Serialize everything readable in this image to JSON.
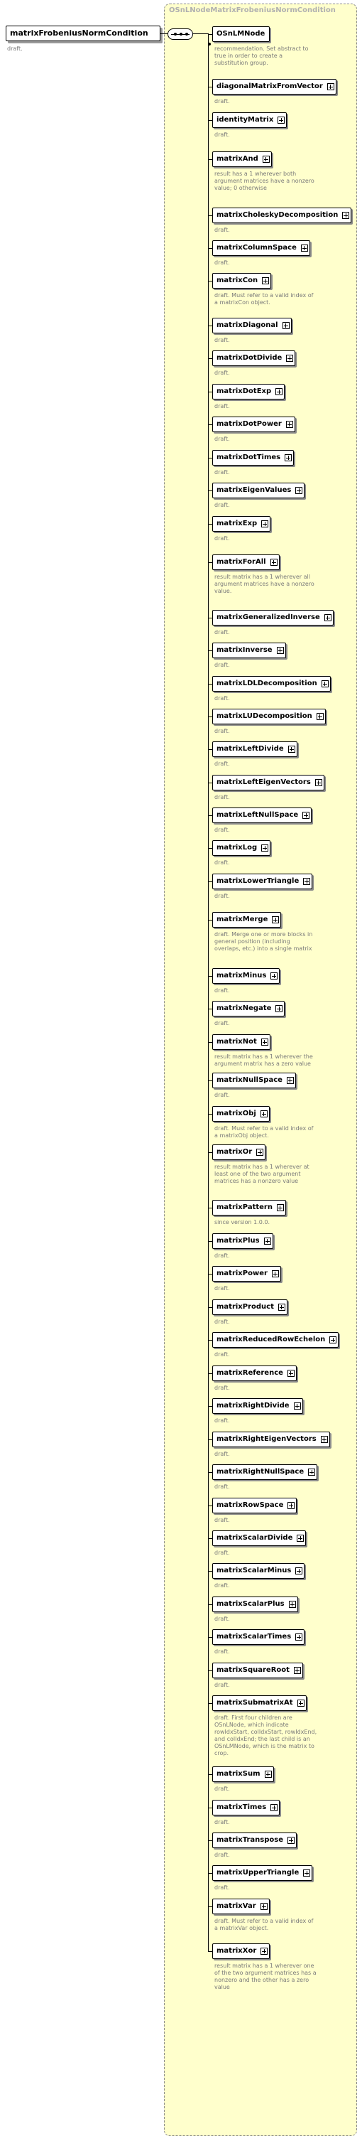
{
  "root": {
    "name": "matrixFrobeniusNormCondition",
    "description": "draft."
  },
  "group": {
    "title": "OSnLNodeMatrixFrobeniusNormCondition"
  },
  "children": [
    {
      "name": "OSnLMNode",
      "expandable": false,
      "description": "recommendation. Set abstract to true in order to create a substitution group."
    },
    {
      "name": "diagonalMatrixFromVector",
      "expandable": true,
      "description": "draft."
    },
    {
      "name": "identityMatrix",
      "expandable": true,
      "description": "draft."
    },
    {
      "name": "matrixAnd",
      "expandable": true,
      "description": "result has a 1 wherever both argument matrices have a nonzero value; 0 otherwise"
    },
    {
      "name": "matrixCholeskyDecomposition",
      "expandable": true,
      "description": "draft."
    },
    {
      "name": "matrixColumnSpace",
      "expandable": true,
      "description": "draft."
    },
    {
      "name": "matrixCon",
      "expandable": true,
      "description": "draft. Must refer to a valid index of a matrixCon object."
    },
    {
      "name": "matrixDiagonal",
      "expandable": true,
      "description": "draft."
    },
    {
      "name": "matrixDotDivide",
      "expandable": true,
      "description": "draft."
    },
    {
      "name": "matrixDotExp",
      "expandable": true,
      "description": "draft."
    },
    {
      "name": "matrixDotPower",
      "expandable": true,
      "description": "draft."
    },
    {
      "name": "matrixDotTimes",
      "expandable": true,
      "description": "draft."
    },
    {
      "name": "matrixEigenValues",
      "expandable": true,
      "description": "draft."
    },
    {
      "name": "matrixExp",
      "expandable": true,
      "description": "draft."
    },
    {
      "name": "matrixForAll",
      "expandable": true,
      "description": "result matrix has a 1 wherever all argument matrices have a nonzero value."
    },
    {
      "name": "matrixGeneralizedInverse",
      "expandable": true,
      "description": "draft."
    },
    {
      "name": "matrixInverse",
      "expandable": true,
      "description": "draft."
    },
    {
      "name": "matrixLDLDecomposition",
      "expandable": true,
      "description": "draft."
    },
    {
      "name": "matrixLUDecomposition",
      "expandable": true,
      "description": "draft."
    },
    {
      "name": "matrixLeftDivide",
      "expandable": true,
      "description": "draft."
    },
    {
      "name": "matrixLeftEigenVectors",
      "expandable": true,
      "description": "draft."
    },
    {
      "name": "matrixLeftNullSpace",
      "expandable": true,
      "description": "draft."
    },
    {
      "name": "matrixLog",
      "expandable": true,
      "description": "draft."
    },
    {
      "name": "matrixLowerTriangle",
      "expandable": true,
      "description": "draft."
    },
    {
      "name": "matrixMerge",
      "expandable": true,
      "description": "draft. Merge one or more blocks in general position (including overlaps, etc.) into a single matrix"
    },
    {
      "name": "matrixMinus",
      "expandable": true,
      "description": "draft."
    },
    {
      "name": "matrixNegate",
      "expandable": true,
      "description": "draft."
    },
    {
      "name": "matrixNot",
      "expandable": true,
      "description": "result matrix has a 1 wherever the argument matrix has a zero value"
    },
    {
      "name": "matrixNullSpace",
      "expandable": true,
      "description": "draft."
    },
    {
      "name": "matrixObj",
      "expandable": true,
      "description": "draft. Must refer to a valid index of a matrixObj object."
    },
    {
      "name": "matrixOr",
      "expandable": true,
      "description": "result matrix has a 1 wherever at least one of the two argument matrices has a nonzero value"
    },
    {
      "name": "matrixPattern",
      "expandable": true,
      "description": "since version 1.0.0."
    },
    {
      "name": "matrixPlus",
      "expandable": true,
      "description": "draft."
    },
    {
      "name": "matrixPower",
      "expandable": true,
      "description": "draft."
    },
    {
      "name": "matrixProduct",
      "expandable": true,
      "description": "draft."
    },
    {
      "name": "matrixReducedRowEchelon",
      "expandable": true,
      "description": "draft."
    },
    {
      "name": "matrixReference",
      "expandable": true,
      "description": "draft."
    },
    {
      "name": "matrixRightDivide",
      "expandable": true,
      "description": "draft."
    },
    {
      "name": "matrixRightEigenVectors",
      "expandable": true,
      "description": "draft."
    },
    {
      "name": "matrixRightNullSpace",
      "expandable": true,
      "description": "draft."
    },
    {
      "name": "matrixRowSpace",
      "expandable": true,
      "description": "draft."
    },
    {
      "name": "matrixScalarDivide",
      "expandable": true,
      "description": "draft."
    },
    {
      "name": "matrixScalarMinus",
      "expandable": true,
      "description": "draft."
    },
    {
      "name": "matrixScalarPlus",
      "expandable": true,
      "description": "draft."
    },
    {
      "name": "matrixScalarTimes",
      "expandable": true,
      "description": "draft."
    },
    {
      "name": "matrixSquareRoot",
      "expandable": true,
      "description": "draft."
    },
    {
      "name": "matrixSubmatrixAt",
      "expandable": true,
      "description": "draft. First four children are OSnLNode, which indicate rowIdxStart, colIdxStart, rowIdxEnd, and colIdxEnd; the last child is an OSnLMNode, which is the matrix to crop."
    },
    {
      "name": "matrixSum",
      "expandable": true,
      "description": "draft."
    },
    {
      "name": "matrixTimes",
      "expandable": true,
      "description": "draft."
    },
    {
      "name": "matrixTranspose",
      "expandable": true,
      "description": "draft."
    },
    {
      "name": "matrixUpperTriangle",
      "expandable": true,
      "description": "draft."
    },
    {
      "name": "matrixVar",
      "expandable": true,
      "description": "draft. Must refer to a valid index of a matrixVar object."
    },
    {
      "name": "matrixXor",
      "expandable": true,
      "description": "result matrix has a 1 wherever one of the two argument matrices has a nonzero and the other has a zero value"
    }
  ]
}
